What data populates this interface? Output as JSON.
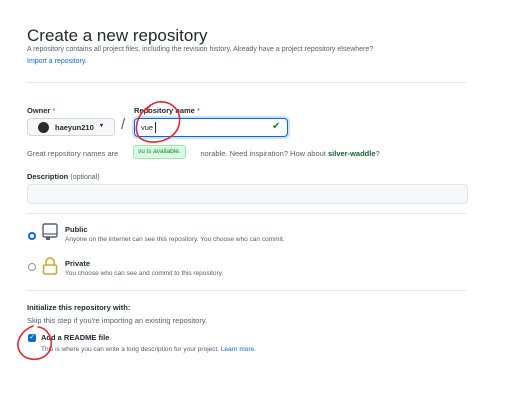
{
  "header": {
    "title": "Create a new repository",
    "subtitle": "A repository contains all project files, including the revision history. Already have a project repository elsewhere?",
    "import_link": "Import a repository."
  },
  "owner": {
    "label": "Owner",
    "required_mark": "*",
    "value": "haeyun210",
    "caret": "▾"
  },
  "separator": "/",
  "repository": {
    "label": "Repository name",
    "required_mark": "*",
    "value": "vue",
    "status_icon": "check-icon",
    "tooltip": "vu is available."
  },
  "hint": {
    "prefix": "Great repository names are",
    "middle": "norable. Need inspiration? How about",
    "suggestion": "silver-waddle",
    "suffix": "?"
  },
  "description": {
    "label": "Description",
    "optional": "(optional)",
    "value": ""
  },
  "visibility": [
    {
      "title": "Public",
      "description": "Anyone on the internet can see this repository. You choose who can commit.",
      "selected": true,
      "icon": "repo-icon"
    },
    {
      "title": "Private",
      "description": "You choose who can see and commit to this repository.",
      "selected": false,
      "icon": "lock-icon"
    }
  ],
  "init": {
    "title": "Initialize this repository with:",
    "description": "Skip this step if you're importing an existing repository.",
    "readme": {
      "label": "Add a README file",
      "description": "This is where you can write a long description for your project.",
      "learn_more": "Learn more.",
      "checked": true
    }
  },
  "colors": {
    "accent": "#0969da",
    "success": "#1a7f37",
    "annotation": "#e8262b"
  }
}
